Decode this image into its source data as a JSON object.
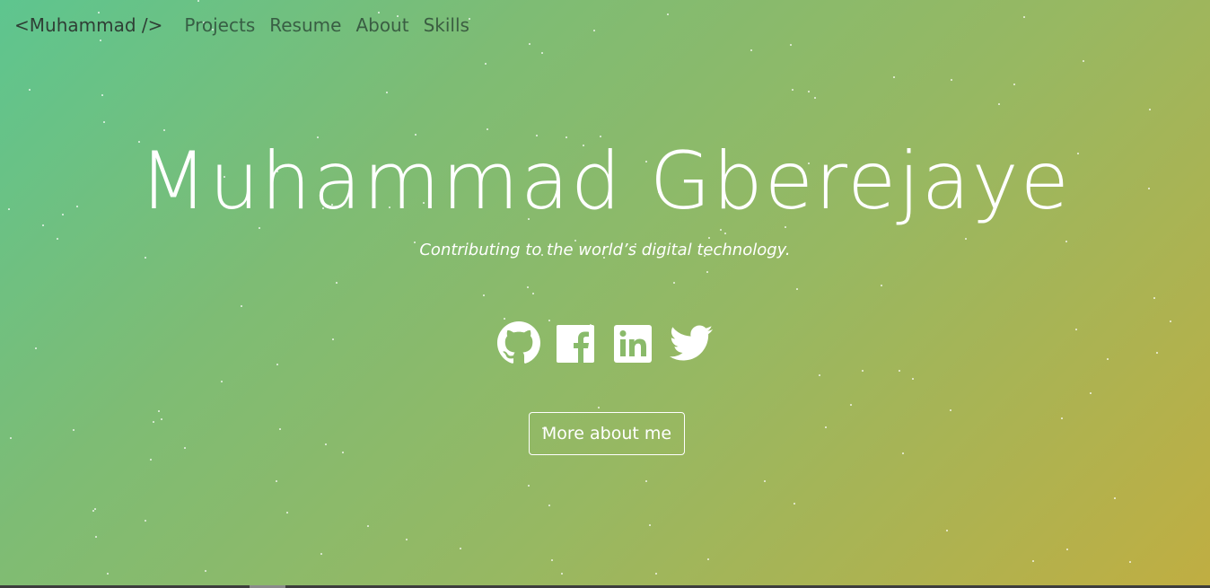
{
  "nav": {
    "brand": "<Muhammad />",
    "links": [
      "Projects",
      "Resume",
      "About",
      "Skills"
    ]
  },
  "hero": {
    "title": "Muhammad Gberejaye",
    "subtitle": "Contributing to the world’s digital technology.",
    "button_label": "More about me"
  },
  "socials": [
    {
      "name": "github-icon"
    },
    {
      "name": "facebook-icon"
    },
    {
      "name": "linkedin-icon"
    },
    {
      "name": "twitter-icon"
    }
  ],
  "colors": {
    "gradient_start": "#5ec58f",
    "gradient_end": "#c0ae42",
    "text": "#ffffff",
    "nav_text": "#2f3e35"
  }
}
